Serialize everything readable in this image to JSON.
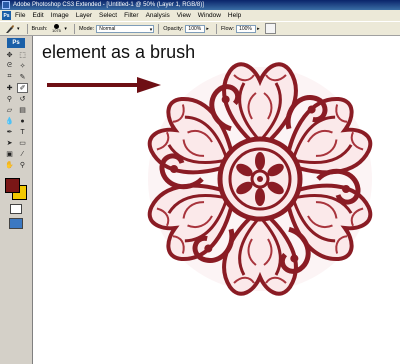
{
  "window": {
    "title": "Adobe Photoshop CS3 Extended - [Untitled-1 @ 50% (Layer 1, RGB/8)]"
  },
  "menubar": {
    "app_badge": "Ps",
    "items": [
      "File",
      "Edit",
      "Image",
      "Layer",
      "Select",
      "Filter",
      "Analysis",
      "View",
      "Window",
      "Help"
    ]
  },
  "options": {
    "brush_label": "Brush:",
    "brush_size": "1075",
    "mode_label": "Mode:",
    "mode_value": "Normal",
    "opacity_label": "Opacity:",
    "opacity_value": "100%",
    "flow_label": "Flow:",
    "flow_value": "100%"
  },
  "toolbox": {
    "badge": "Ps",
    "fg_color": "#7a1616",
    "bg_color": "#f2c800",
    "active_tool": "brush-tool"
  },
  "canvas": {
    "annotation": "element as a brush",
    "arrow_color": "#6e0f14",
    "brush_color": "#8a1c24"
  }
}
